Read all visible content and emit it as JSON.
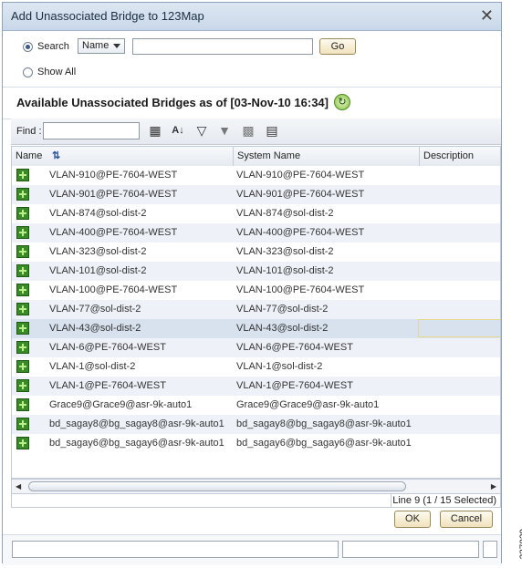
{
  "dialog": {
    "title": "Add Unassociated Bridge to 123Map",
    "close_glyph": "✕"
  },
  "search_panel": {
    "search_label": "Search",
    "search_selected": true,
    "field_select_value": "Name",
    "search_value": "",
    "go_label": "Go",
    "show_all_label": "Show All",
    "show_all_selected": false
  },
  "heading": {
    "text": "Available Unassociated Bridges as of [03-Nov-10 16:34]",
    "refresh_icon": "refresh-icon"
  },
  "findbar": {
    "find_label": "Find :",
    "find_value": "",
    "icons": [
      "table-settings-icon",
      "sort-az-icon",
      "filter-icon",
      "filter-clear-icon",
      "export-icon",
      "column-chooser-icon"
    ]
  },
  "table": {
    "columns": [
      {
        "label": "Name"
      },
      {
        "label": "System Name"
      },
      {
        "label": "Description"
      }
    ],
    "sort_indicator": "⇅",
    "rows": [
      {
        "name": "VLAN-910@PE-7604-WEST",
        "system_name": "VLAN-910@PE-7604-WEST",
        "description": ""
      },
      {
        "name": "VLAN-901@PE-7604-WEST",
        "system_name": "VLAN-901@PE-7604-WEST",
        "description": ""
      },
      {
        "name": "VLAN-874@sol-dist-2",
        "system_name": "VLAN-874@sol-dist-2",
        "description": ""
      },
      {
        "name": "VLAN-400@PE-7604-WEST",
        "system_name": "VLAN-400@PE-7604-WEST",
        "description": ""
      },
      {
        "name": "VLAN-323@sol-dist-2",
        "system_name": "VLAN-323@sol-dist-2",
        "description": ""
      },
      {
        "name": "VLAN-101@sol-dist-2",
        "system_name": "VLAN-101@sol-dist-2",
        "description": ""
      },
      {
        "name": "VLAN-100@PE-7604-WEST",
        "system_name": "VLAN-100@PE-7604-WEST",
        "description": ""
      },
      {
        "name": "VLAN-77@sol-dist-2",
        "system_name": "VLAN-77@sol-dist-2",
        "description": ""
      },
      {
        "name": "VLAN-43@sol-dist-2",
        "system_name": "VLAN-43@sol-dist-2",
        "description": "",
        "selected": true
      },
      {
        "name": "VLAN-6@PE-7604-WEST",
        "system_name": "VLAN-6@PE-7604-WEST",
        "description": ""
      },
      {
        "name": "VLAN-1@sol-dist-2",
        "system_name": "VLAN-1@sol-dist-2",
        "description": ""
      },
      {
        "name": "VLAN-1@PE-7604-WEST",
        "system_name": "VLAN-1@PE-7604-WEST",
        "description": ""
      },
      {
        "name": "Grace9@Grace9@asr-9k-auto1",
        "system_name": "Grace9@Grace9@asr-9k-auto1",
        "description": ""
      },
      {
        "name": "bd_sagay8@bg_sagay8@asr-9k-auto1",
        "system_name": "bd_sagay8@bg_sagay8@asr-9k-auto1",
        "description": ""
      },
      {
        "name": "bd_sagay6@bg_sagay6@asr-9k-auto1",
        "system_name": "bd_sagay6@bg_sagay6@asr-9k-auto1",
        "description": ""
      }
    ]
  },
  "status": {
    "text": "Line 9 (1 / 15 Selected)"
  },
  "buttons": {
    "ok_label": "OK",
    "cancel_label": "Cancel"
  },
  "figure_id": "237029",
  "colors": {
    "title_bar": "#c9d8e9",
    "selected_row": "#d8e2ee",
    "alt_row": "#eef2f8",
    "button": "#f0e2bc"
  }
}
